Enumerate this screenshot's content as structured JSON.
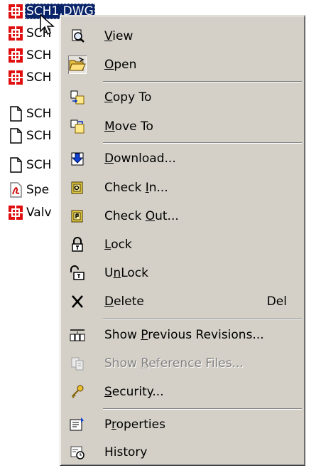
{
  "files": [
    {
      "name": "SCH1.DWG",
      "icon": "dwg-file-icon",
      "selected": true
    },
    {
      "name": "SCH",
      "icon": "dwg-file-icon"
    },
    {
      "name": "SCH",
      "icon": "dwg-file-icon"
    },
    {
      "name": "SCH",
      "icon": "dwg-file-icon"
    },
    {
      "name": "SCH",
      "icon": "blank-file-icon"
    },
    {
      "name": "SCH",
      "icon": "blank-file-icon"
    },
    {
      "name": "SCH",
      "icon": "blank-file-icon"
    },
    {
      "name": "Spe",
      "icon": "pdf-file-icon"
    },
    {
      "name": "Valv",
      "icon": "dwg-file-icon"
    }
  ],
  "menu": {
    "items": [
      {
        "label": "View",
        "mnemonic": "V",
        "icon": "view-icon"
      },
      {
        "label": "Open",
        "mnemonic": "O",
        "icon": "open-folder-icon",
        "active": true
      },
      {
        "label": "Copy To",
        "mnemonic": "C",
        "icon": "copy-to-icon"
      },
      {
        "label": "Move To",
        "mnemonic": "M",
        "icon": "move-to-icon"
      },
      {
        "label": "Download...",
        "mnemonic": "D",
        "icon": "download-icon"
      },
      {
        "label": "Check In...",
        "mnemonic": "I",
        "icon": "check-in-icon"
      },
      {
        "label": "Check Out...",
        "mnemonic": "O",
        "icon": "check-out-icon"
      },
      {
        "label": "Lock",
        "mnemonic": "L",
        "icon": "lock-icon"
      },
      {
        "label": "UnLock",
        "mnemonic": "n",
        "icon": "unlock-icon"
      },
      {
        "label": "Delete",
        "mnemonic": "D",
        "icon": "delete-icon",
        "shortcut": "Del"
      },
      {
        "label": "Show Previous Revisions...",
        "mnemonic": "P",
        "icon": "revisions-icon"
      },
      {
        "label": "Show Reference Files...",
        "mnemonic": "R",
        "icon": "reference-files-icon",
        "disabled": true
      },
      {
        "label": "Security...",
        "mnemonic": "S",
        "icon": "key-icon"
      },
      {
        "label": "Properties",
        "mnemonic": "r",
        "icon": "properties-icon"
      },
      {
        "label": "History",
        "mnemonic": "",
        "icon": "history-icon"
      }
    ]
  },
  "colors": {
    "menu_bg": "#d4d0c8",
    "selection": "#0a246a",
    "disabled_text": "#808080",
    "dwg_red": "#e01010"
  }
}
